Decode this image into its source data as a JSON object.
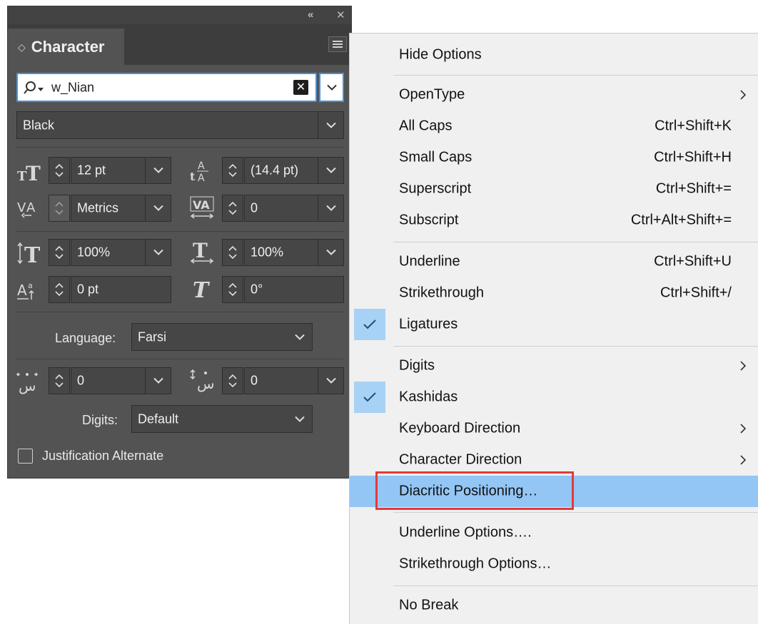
{
  "panel": {
    "title": "Character",
    "font_search": {
      "value": "w_Nian"
    },
    "font_style": "Black",
    "size": "12 pt",
    "leading": "(14.4 pt)",
    "kerning": "Metrics",
    "tracking": "0",
    "vertical_scale": "100%",
    "horizontal_scale": "100%",
    "baseline_shift": "0 pt",
    "skew": "0°",
    "language_label": "Language:",
    "language": "Farsi",
    "diacritic_x": "0",
    "diacritic_y": "0",
    "digits_label": "Digits:",
    "digits": "Default",
    "justification_alternate": "Justification Alternate"
  },
  "menu": {
    "hide_options": "Hide Options",
    "opentype": "OpenType",
    "all_caps": {
      "label": "All Caps",
      "shortcut": "Ctrl+Shift+K"
    },
    "small_caps": {
      "label": "Small Caps",
      "shortcut": "Ctrl+Shift+H"
    },
    "superscript": {
      "label": "Superscript",
      "shortcut": "Ctrl+Shift+="
    },
    "subscript": {
      "label": "Subscript",
      "shortcut": "Ctrl+Alt+Shift+="
    },
    "underline": {
      "label": "Underline",
      "shortcut": "Ctrl+Shift+U"
    },
    "strikethrough": {
      "label": "Strikethrough",
      "shortcut": "Ctrl+Shift+/"
    },
    "ligatures": {
      "label": "Ligatures",
      "checked": true
    },
    "digits": "Digits",
    "kashidas": {
      "label": "Kashidas",
      "checked": true
    },
    "keyboard_direction": "Keyboard Direction",
    "character_direction": "Character Direction",
    "diacritic_positioning": "Diacritic Positioning…",
    "underline_options": "Underline Options….",
    "strikethrough_options": "Strikethrough Options…",
    "no_break": "No Break"
  },
  "colors": {
    "panel_bg": "#535353",
    "menu_bg": "#f0f0f0",
    "highlight": "#93c5f5",
    "check_bg": "#a8d2f5",
    "callout": "#e53935"
  }
}
